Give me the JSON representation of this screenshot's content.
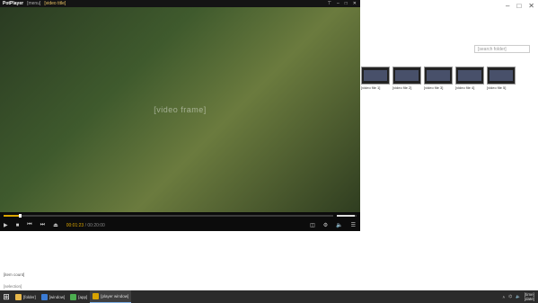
{
  "explorer": {
    "search_placeholder": "[search folder]",
    "files": [
      {
        "name": "[video file 1]"
      },
      {
        "name": "[video file 2]"
      },
      {
        "name": "[video file 3]"
      },
      {
        "name": "[video file 4]"
      },
      {
        "name": "[video file 5]"
      }
    ],
    "status_items": "[item count]",
    "status_selection": "[selection]"
  },
  "player": {
    "brand": "PotPlayer",
    "menu": "[menu]",
    "title": "[video title]",
    "video_placeholder": "[video frame]",
    "progress_fraction": 0.05,
    "volume_fraction": 0.9,
    "time_current": "00:01:23",
    "time_total": "00:20:00"
  },
  "taskbar": {
    "items": [
      {
        "label": "[folder]"
      },
      {
        "label": "[window]"
      },
      {
        "label": "[app]"
      },
      {
        "label": "[player window]"
      }
    ],
    "clock_time": "[time]",
    "clock_date": "[date]"
  },
  "colors": {
    "accent": "#d9a400",
    "taskbar": "#2b2b2b",
    "player_bg": "#0c0c0c"
  }
}
